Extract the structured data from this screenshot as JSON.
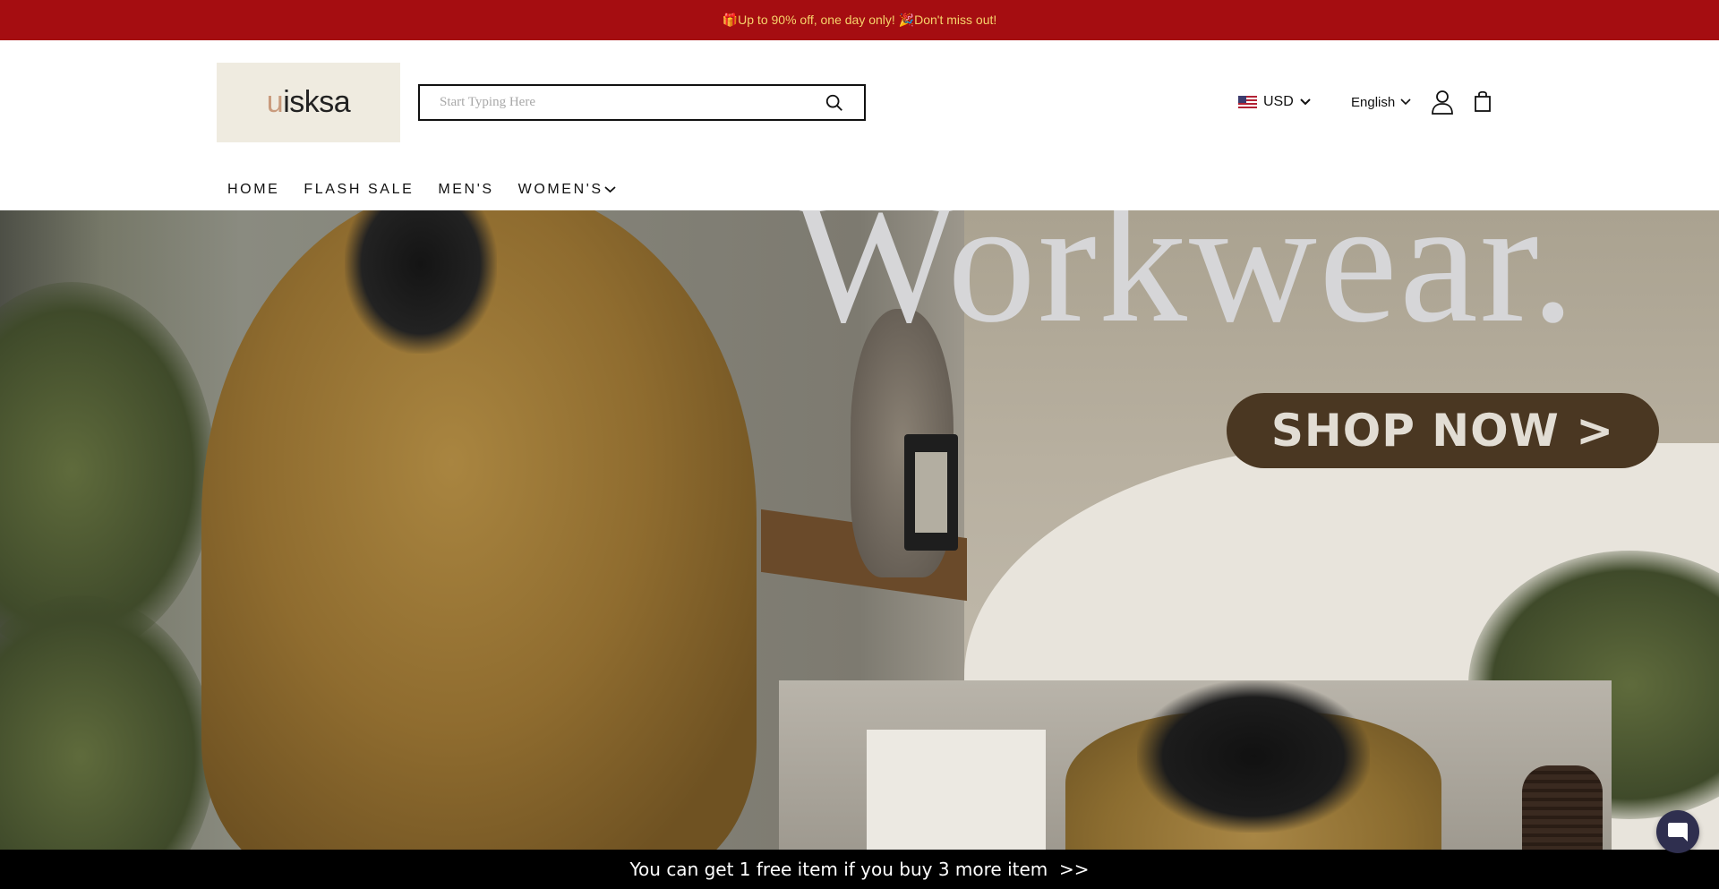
{
  "announcement": {
    "text": "🎁Up to 90% off, one day only! 🎉Don't miss out!"
  },
  "header": {
    "logo": {
      "text_u": "u",
      "text_rest": "isksa"
    },
    "search": {
      "placeholder": "Start Typing Here",
      "value": ""
    },
    "currency": {
      "label": "USD",
      "flag": "us-flag-icon"
    },
    "language": {
      "label": "English"
    },
    "icons": {
      "account": "user-icon",
      "cart": "shopping-bag-icon",
      "search": "search-icon"
    }
  },
  "nav": {
    "items": [
      {
        "label": "HOME"
      },
      {
        "label": "FLASH SALE"
      },
      {
        "label": "MEN'S"
      },
      {
        "label": "WOMEN'S"
      }
    ]
  },
  "hero": {
    "title": "Workwear.",
    "cta": "SHOP NOW >"
  },
  "promo_bar": {
    "text": "You can get 1 free item if you buy 3 more item  >>"
  },
  "colors": {
    "announcement_bg": "#a50d11",
    "announcement_text": "#f6d36b",
    "cta_bg": "#4a3722",
    "promo_bg": "#000000",
    "chat_bg": "#2f2f4f"
  }
}
